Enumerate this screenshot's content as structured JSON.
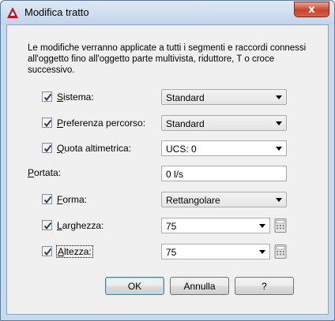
{
  "window": {
    "title": "Modifica tratto",
    "close_glyph": "x"
  },
  "description": "Le modifiche verranno applicate a tutti i segmenti e raccordi connessi all'oggetto fino all'oggetto parte multivista, riduttore, T o croce successivo.",
  "fields": [
    {
      "key": "sistema",
      "label_accel": "S",
      "label_rest": "istema:",
      "checkbox": true,
      "checked": true,
      "control": "dropdown",
      "value": "Standard"
    },
    {
      "key": "preferenza",
      "label_accel": "P",
      "label_rest": "referenza percorso:",
      "checkbox": true,
      "checked": true,
      "control": "dropdown",
      "value": "Standard"
    },
    {
      "key": "quota",
      "label_accel": "Q",
      "label_rest": "uota altimetrica:",
      "checkbox": true,
      "checked": true,
      "control": "combo-edit",
      "value": "UCS: 0"
    },
    {
      "key": "portata",
      "label_accel": "P",
      "label_rest": "ortata:",
      "checkbox": false,
      "checked": false,
      "control": "text",
      "value": "0 l/s"
    },
    {
      "key": "forma",
      "label_accel": "F",
      "label_rest": "orma:",
      "checkbox": true,
      "checked": true,
      "control": "dropdown",
      "value": "Rettangolare"
    },
    {
      "key": "larghezza",
      "label_accel": "L",
      "label_rest": "arghezza:",
      "checkbox": true,
      "checked": true,
      "control": "combo-edit",
      "value": "75"
    },
    {
      "key": "altezza",
      "label_accel": "A",
      "label_rest": "ltezza:",
      "checkbox": true,
      "checked": true,
      "control": "combo-edit",
      "value": "75"
    }
  ],
  "buttons": {
    "ok": "OK",
    "cancel": "Annulla",
    "help": "?"
  },
  "colors": {
    "title_bar": "#c2d4ea",
    "close_button": "#c8442c",
    "dialog_bg": "#f0f0f0",
    "default_button_border": "#3c7fb1"
  },
  "icons": {
    "app": "autocad-logo-icon",
    "calculator": "calculator-icon",
    "checkmark": "checkmark-icon",
    "dropdown": "chevron-down-icon"
  }
}
